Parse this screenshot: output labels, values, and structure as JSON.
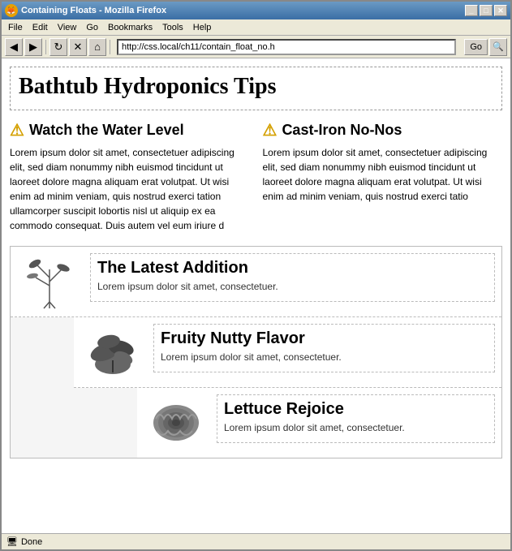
{
  "window": {
    "title": "Containing Floats - Mozilla Firefox",
    "icon": "🦊"
  },
  "titlebar": {
    "text": "Containing Floats - Mozilla Firefox",
    "min_label": "_",
    "max_label": "□",
    "close_label": "✕"
  },
  "menu": {
    "items": [
      "File",
      "Edit",
      "View",
      "Go",
      "Bookmarks",
      "Tools",
      "Help"
    ]
  },
  "toolbar": {
    "address": "http://css.local/ch11/contain_float_no.h",
    "go_label": "Go"
  },
  "page": {
    "main_title": "Bathtub Hydroponics Tips",
    "col1": {
      "heading": "Watch the Water Level",
      "text": "Lorem ipsum dolor sit amet, consectetuer adipiscing elit, sed diam nonummy nibh euismod tincidunt ut laoreet dolore magna aliquam erat volutpat. Ut wisi enim ad minim veniam, quis nostrud exerci tation ullamcorper suscipit lobortis nisl ut aliquip ex ea commodo consequat. Duis autem vel eum iriure d"
    },
    "col2": {
      "heading": "Cast-Iron No-Nos",
      "text": "Lorem ipsum dolor sit amet, consectetuer adipiscing elit, sed diam nonummy nibh euismod tincidunt ut laoreet dolore magna aliquam erat volutpat. Ut wisi enim ad minim veniam, quis nostrud exerci tatio"
    },
    "cards": [
      {
        "title": "The Latest Addition",
        "desc": "Lorem ipsum dolor sit amet, consectetuer.",
        "image_alt": "sprout-plant"
      },
      {
        "title": "Fruity Nutty Flavor",
        "desc": "Lorem ipsum dolor sit amet, consectetuer.",
        "image_alt": "leafy-plant"
      },
      {
        "title": "Lettuce Rejoice",
        "desc": "Lorem ipsum dolor sit amet, consectetuer.",
        "image_alt": "lettuce-plant"
      }
    ]
  },
  "status": {
    "text": "Done"
  }
}
